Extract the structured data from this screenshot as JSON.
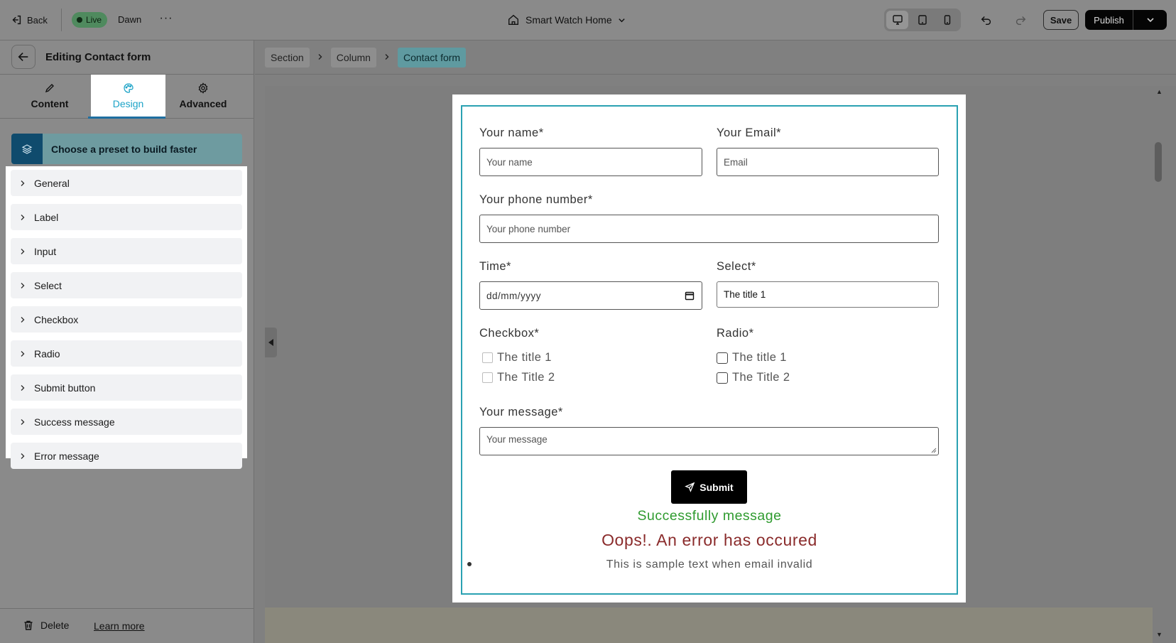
{
  "topbar": {
    "back_label": "Back",
    "live_label": "Live",
    "theme_name": "Dawn",
    "more_label": "···",
    "page_name": "Smart Watch Home",
    "save_label": "Save",
    "publish_label": "Publish"
  },
  "panel": {
    "title": "Editing Contact form",
    "tabs": [
      {
        "label": "Content",
        "icon": "pencil-icon"
      },
      {
        "label": "Design",
        "icon": "palette-icon",
        "active": true
      },
      {
        "label": "Advanced",
        "icon": "gear-icon"
      }
    ],
    "preset_label": "Choose a preset to build faster",
    "sections": [
      "General",
      "Label",
      "Input",
      "Select",
      "Checkbox",
      "Radio",
      "Submit button",
      "Success message",
      "Error message"
    ],
    "delete_label": "Delete",
    "learn_more_label": "Learn more"
  },
  "breadcrumbs": [
    "Section",
    "Column",
    "Contact form"
  ],
  "form": {
    "name_label": "Your name*",
    "name_placeholder": "Your name",
    "email_label": "Your Email*",
    "email_placeholder": "Email",
    "phone_label": "Your phone number*",
    "phone_placeholder": "Your phone number",
    "time_label": "Time*",
    "time_placeholder": "dd/mm/yyyy",
    "select_label": "Select*",
    "select_value": "The title 1",
    "checkbox_label": "Checkbox*",
    "checkbox_options": [
      "The title 1",
      "The Title 2"
    ],
    "radio_label": "Radio*",
    "radio_options": [
      "The title 1",
      "The Title 2"
    ],
    "message_label": "Your message*",
    "message_placeholder": "Your message",
    "submit_label": "Submit",
    "success_message": "Successfully message",
    "error_message": "Oops!. An error has occured",
    "sample_text": "This is sample text when email invalid"
  },
  "colors": {
    "accent": "#1ca3c7",
    "frame": "#2aa1b2",
    "success": "#2f9b2f",
    "error": "#8a2b2b",
    "live": "#4f8a5e"
  }
}
